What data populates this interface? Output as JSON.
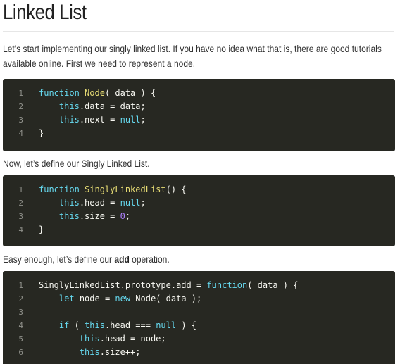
{
  "article": {
    "title": "Linked List",
    "intro_line1": "Let’s start implementing our singly linked list. If you have no idea what that is, there are good tutorials",
    "intro_line2": "available online. First we need to represent a node.",
    "p2": "Now, let’s define our Singly Linked List.",
    "p3_before": "Easy enough, let’s define our ",
    "p3_bold": "add",
    "p3_after": " operation."
  },
  "code_blocks": [
    {
      "lines": [
        {
          "n": "1",
          "tokens": [
            {
              "t": "function ",
              "c": "kw"
            },
            {
              "t": "Node",
              "c": "fn"
            },
            {
              "t": "( data ) {",
              "c": "pl"
            }
          ]
        },
        {
          "n": "2",
          "tokens": [
            {
              "t": "    ",
              "c": "pl"
            },
            {
              "t": "this",
              "c": "kw"
            },
            {
              "t": ".data = data;",
              "c": "pl"
            }
          ]
        },
        {
          "n": "3",
          "tokens": [
            {
              "t": "    ",
              "c": "pl"
            },
            {
              "t": "this",
              "c": "kw"
            },
            {
              "t": ".next = ",
              "c": "pl"
            },
            {
              "t": "null",
              "c": "kw"
            },
            {
              "t": ";",
              "c": "pl"
            }
          ]
        },
        {
          "n": "4",
          "tokens": [
            {
              "t": "}",
              "c": "pl"
            }
          ]
        }
      ]
    },
    {
      "lines": [
        {
          "n": "1",
          "tokens": [
            {
              "t": "function ",
              "c": "kw"
            },
            {
              "t": "SinglyLinkedList",
              "c": "fn"
            },
            {
              "t": "() {",
              "c": "pl"
            }
          ]
        },
        {
          "n": "2",
          "tokens": [
            {
              "t": "    ",
              "c": "pl"
            },
            {
              "t": "this",
              "c": "kw"
            },
            {
              "t": ".head = ",
              "c": "pl"
            },
            {
              "t": "null",
              "c": "kw"
            },
            {
              "t": ";",
              "c": "pl"
            }
          ]
        },
        {
          "n": "3",
          "tokens": [
            {
              "t": "    ",
              "c": "pl"
            },
            {
              "t": "this",
              "c": "kw"
            },
            {
              "t": ".size = ",
              "c": "pl"
            },
            {
              "t": "0",
              "c": "num"
            },
            {
              "t": ";",
              "c": "pl"
            }
          ]
        },
        {
          "n": "4",
          "tokens": [
            {
              "t": "}",
              "c": "pl"
            }
          ]
        }
      ]
    },
    {
      "lines": [
        {
          "n": "1",
          "tokens": [
            {
              "t": "SinglyLinkedList.prototype.add = ",
              "c": "pl"
            },
            {
              "t": "function",
              "c": "kw"
            },
            {
              "t": "( data ) {",
              "c": "pl"
            }
          ]
        },
        {
          "n": "2",
          "tokens": [
            {
              "t": "    ",
              "c": "pl"
            },
            {
              "t": "let",
              "c": "kw"
            },
            {
              "t": " node = ",
              "c": "pl"
            },
            {
              "t": "new",
              "c": "kw"
            },
            {
              "t": " Node( data );",
              "c": "pl"
            }
          ]
        },
        {
          "n": "3",
          "tokens": []
        },
        {
          "n": "4",
          "tokens": [
            {
              "t": "    ",
              "c": "pl"
            },
            {
              "t": "if",
              "c": "kw"
            },
            {
              "t": " ( ",
              "c": "pl"
            },
            {
              "t": "this",
              "c": "kw"
            },
            {
              "t": ".head === ",
              "c": "pl"
            },
            {
              "t": "null",
              "c": "kw"
            },
            {
              "t": " ) {",
              "c": "pl"
            }
          ]
        },
        {
          "n": "5",
          "tokens": [
            {
              "t": "        ",
              "c": "pl"
            },
            {
              "t": "this",
              "c": "kw"
            },
            {
              "t": ".head = node;",
              "c": "pl"
            }
          ]
        },
        {
          "n": "6",
          "tokens": [
            {
              "t": "        ",
              "c": "pl"
            },
            {
              "t": "this",
              "c": "kw"
            },
            {
              "t": ".size++;",
              "c": "pl"
            }
          ]
        }
      ]
    }
  ],
  "colors": {
    "code_background": "#272822",
    "keyword": "#66d9ef",
    "function_name": "#e6db74",
    "number": "#ae81ff",
    "plain": "#f8f8f2",
    "line_number": "#8f908a"
  }
}
